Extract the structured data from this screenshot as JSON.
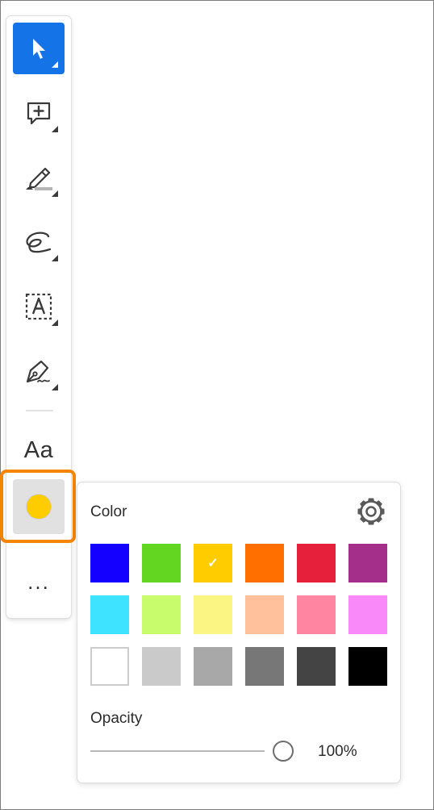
{
  "toolbar": {
    "tools": [
      {
        "name": "select-tool",
        "icon": "pointer-arrow-icon",
        "selected": true
      },
      {
        "name": "add-comment-tool",
        "icon": "comment-plus-icon"
      },
      {
        "name": "highlight-tool",
        "icon": "highlighter-icon"
      },
      {
        "name": "draw-tool",
        "icon": "freehand-loop-icon"
      },
      {
        "name": "text-box-tool",
        "icon": "text-box-icon"
      },
      {
        "name": "sign-tool",
        "icon": "pen-nib-icon"
      }
    ],
    "text_tool_label": "Aa",
    "current_color": "#ffcc00",
    "more_label": "..."
  },
  "color_panel": {
    "title": "Color",
    "settings_icon": "gear-icon",
    "selected_color": "#ffcc00",
    "swatches": [
      [
        "#1400ff",
        "#62d620",
        "#ffcc00",
        "#ff6f00",
        "#e6203a",
        "#a32f8b"
      ],
      [
        "#3ee4ff",
        "#c9fc6d",
        "#fbf584",
        "#ffc09b",
        "#ff85a0",
        "#f989f9"
      ],
      [
        "#ffffff",
        "#cacaca",
        "#a8a8a8",
        "#777777",
        "#444444",
        "#000000"
      ]
    ],
    "check_mark": "✓",
    "opacity_label": "Opacity",
    "opacity": 1.0,
    "opacity_text": "100%"
  },
  "highlight_color": "#f58400"
}
